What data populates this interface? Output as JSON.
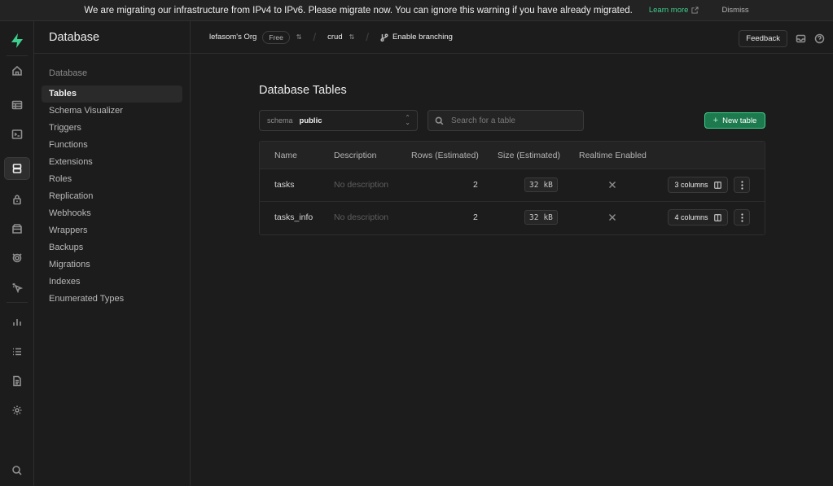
{
  "banner": {
    "message": "We are migrating our infrastructure from IPv4 to IPv6. Please migrate now. You can ignore this warning if you have already migrated.",
    "learn_more": "Learn more",
    "dismiss": "Dismiss"
  },
  "rail": {
    "items": [
      "home-icon",
      "table-editor-icon",
      "sql-editor-icon",
      "database-icon",
      "auth-icon",
      "storage-icon",
      "edge-functions-icon",
      "realtime-icon",
      "reports-icon",
      "logs-icon",
      "api-docs-icon",
      "settings-icon",
      "search-icon"
    ],
    "active": "database-icon"
  },
  "sidebar": {
    "title": "Database",
    "section": "Database",
    "items": [
      {
        "label": "Tables"
      },
      {
        "label": "Schema Visualizer"
      },
      {
        "label": "Triggers"
      },
      {
        "label": "Functions"
      },
      {
        "label": "Extensions"
      },
      {
        "label": "Roles"
      },
      {
        "label": "Replication"
      },
      {
        "label": "Webhooks"
      },
      {
        "label": "Wrappers"
      },
      {
        "label": "Backups"
      },
      {
        "label": "Migrations"
      },
      {
        "label": "Indexes"
      },
      {
        "label": "Enumerated Types"
      }
    ],
    "active_item": "Tables"
  },
  "topbar": {
    "org": "lefasom's Org",
    "plan_badge": "Free",
    "project": "crud",
    "branching": "Enable branching",
    "feedback": "Feedback"
  },
  "main": {
    "title": "Database Tables",
    "schema_label": "schema",
    "schema_value": "public",
    "search_placeholder": "Search for a table",
    "new_table": "New table",
    "columns": [
      "Name",
      "Description",
      "Rows (Estimated)",
      "Size (Estimated)",
      "Realtime Enabled"
    ],
    "rows": [
      {
        "name": "tasks",
        "description": "No description",
        "rows": "2",
        "size_value": "32",
        "size_unit": "kB",
        "columns_btn": "3 columns"
      },
      {
        "name": "tasks_info",
        "description": "No description",
        "rows": "2",
        "size_value": "32",
        "size_unit": "kB",
        "columns_btn": "4 columns"
      }
    ]
  },
  "colors": {
    "accent": "#3ecf8e",
    "background": "#1c1c1c",
    "border": "#2e2e2e"
  }
}
